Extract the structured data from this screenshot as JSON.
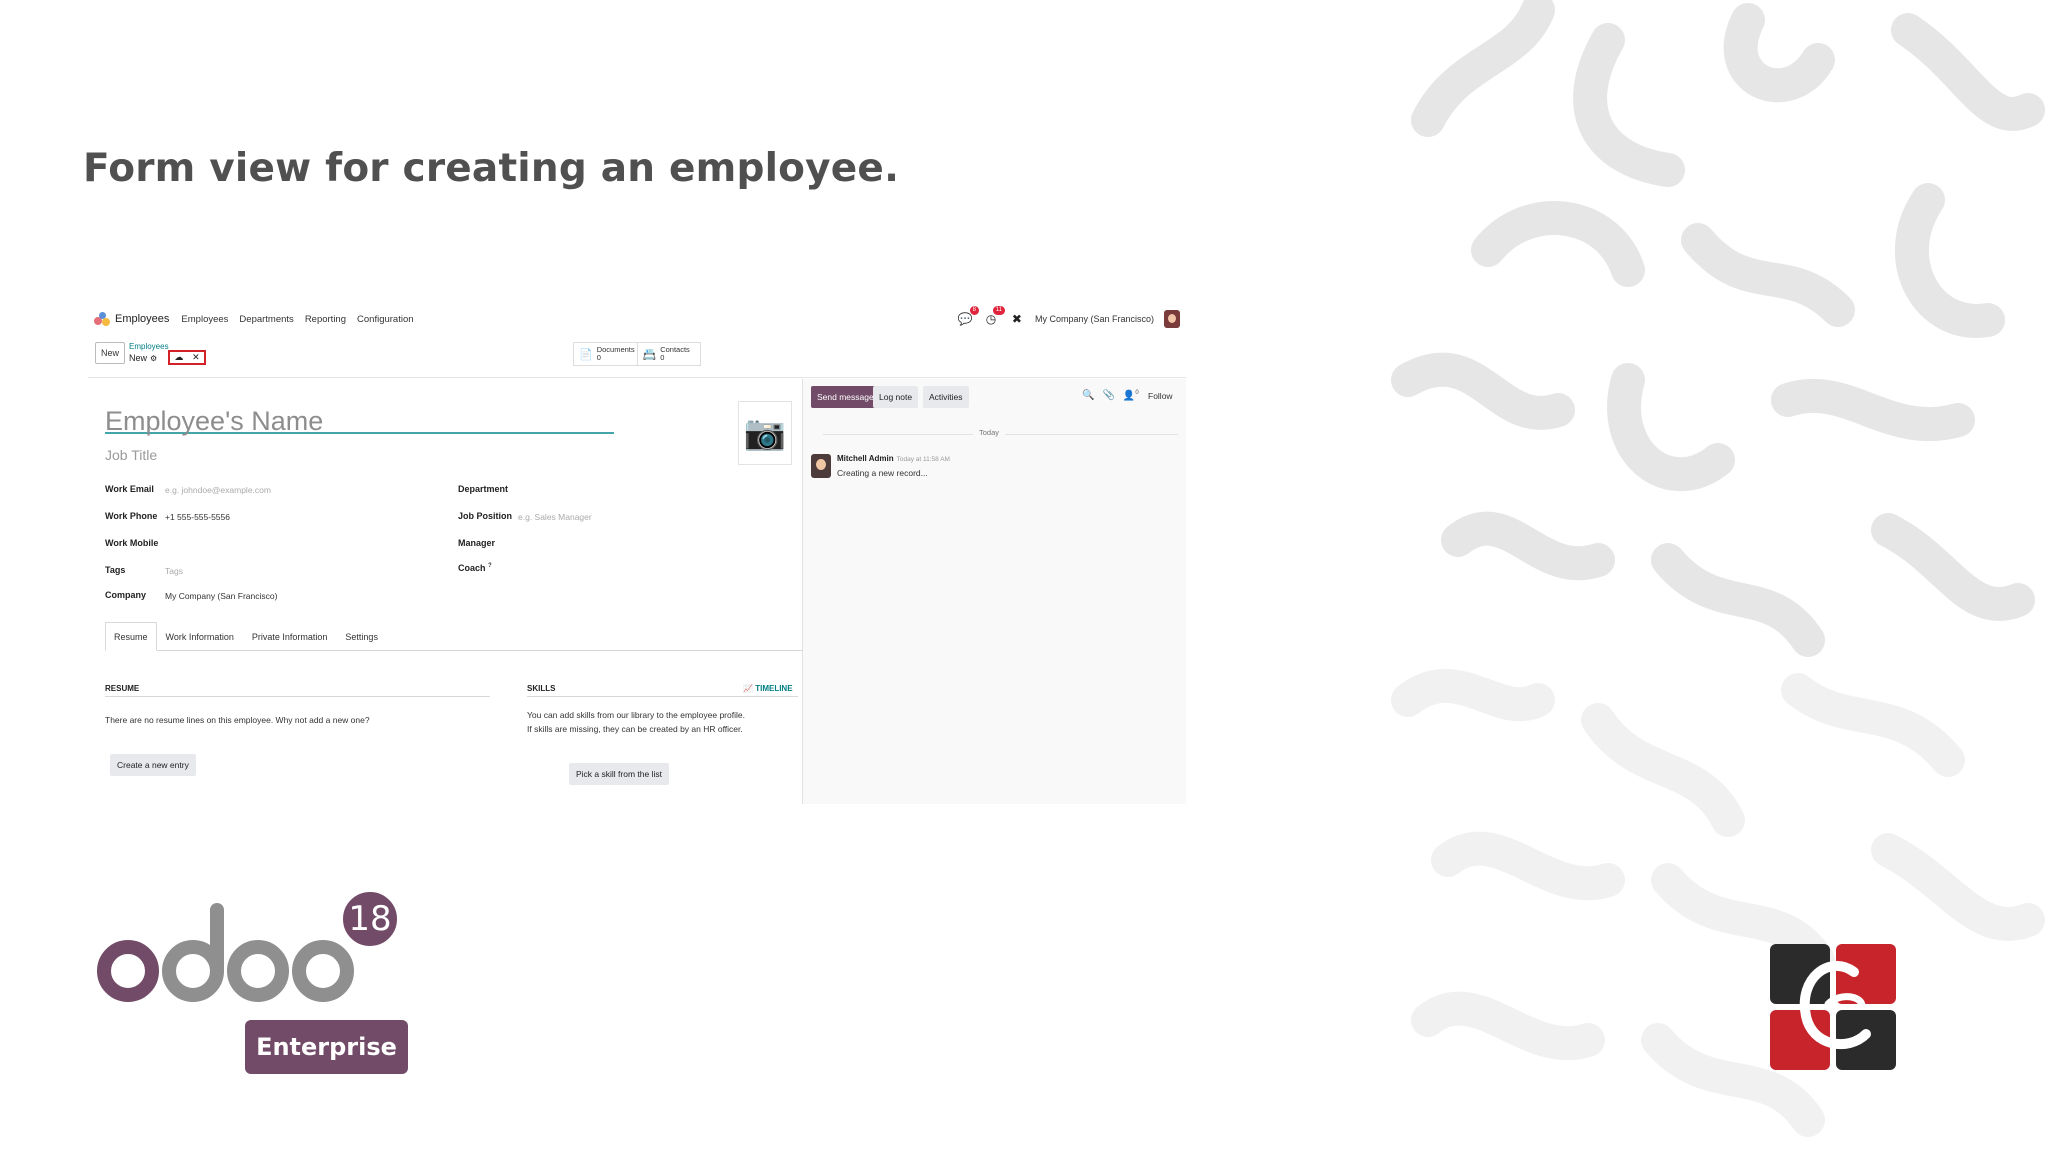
{
  "slide": {
    "title": "Form view for creating an employee."
  },
  "topbar": {
    "app_name": "Employees",
    "menu": [
      "Employees",
      "Departments",
      "Reporting",
      "Configuration"
    ],
    "chat_badge": "8",
    "activity_badge": "11",
    "company": "My Company (San Francisco)"
  },
  "controlbar": {
    "new_label": "New",
    "breadcrumb_parent": "Employees",
    "breadcrumb_current": "New",
    "documents_label": "Documents",
    "documents_count": "0",
    "contacts_label": "Contacts",
    "contacts_count": "0"
  },
  "form": {
    "name_placeholder": "Employee's Name",
    "job_title_placeholder": "Job Title",
    "work_email_label": "Work Email",
    "work_email_placeholder": "e.g. johndoe@example.com",
    "work_phone_label": "Work Phone",
    "work_phone_value": "+1 555-555-5556",
    "work_mobile_label": "Work Mobile",
    "tags_label": "Tags",
    "tags_placeholder": "Tags",
    "company_label": "Company",
    "company_value": "My Company (San Francisco)",
    "department_label": "Department",
    "job_position_label": "Job Position",
    "job_position_placeholder": "e.g. Sales Manager",
    "manager_label": "Manager",
    "coach_label": "Coach",
    "coach_sup": "?"
  },
  "tabs": [
    "Resume",
    "Work Information",
    "Private Information",
    "Settings"
  ],
  "resume": {
    "title": "RESUME",
    "empty_text": "There are no resume lines on this employee. Why not add a new one?",
    "button": "Create a new entry"
  },
  "skills": {
    "title": "SKILLS",
    "timeline": "TIMELINE",
    "text_line1": "You can add skills from our library to the employee profile.",
    "text_line2": "If skills are missing, they can be created by an HR officer.",
    "button": "Pick a skill from the list"
  },
  "chatter": {
    "send_message": "Send message",
    "log_note": "Log note",
    "activities": "Activities",
    "followers_count": "0",
    "follow": "Follow",
    "today": "Today",
    "author": "Mitchell Admin",
    "time": "Today at 11:58 AM",
    "message": "Creating a new record..."
  },
  "logo": {
    "wordmark": "odoo",
    "version": "18",
    "edition": "Enterprise"
  },
  "colors": {
    "brand_purple": "#714b67",
    "teal": "#017e84",
    "highlight_red": "#d42027"
  }
}
